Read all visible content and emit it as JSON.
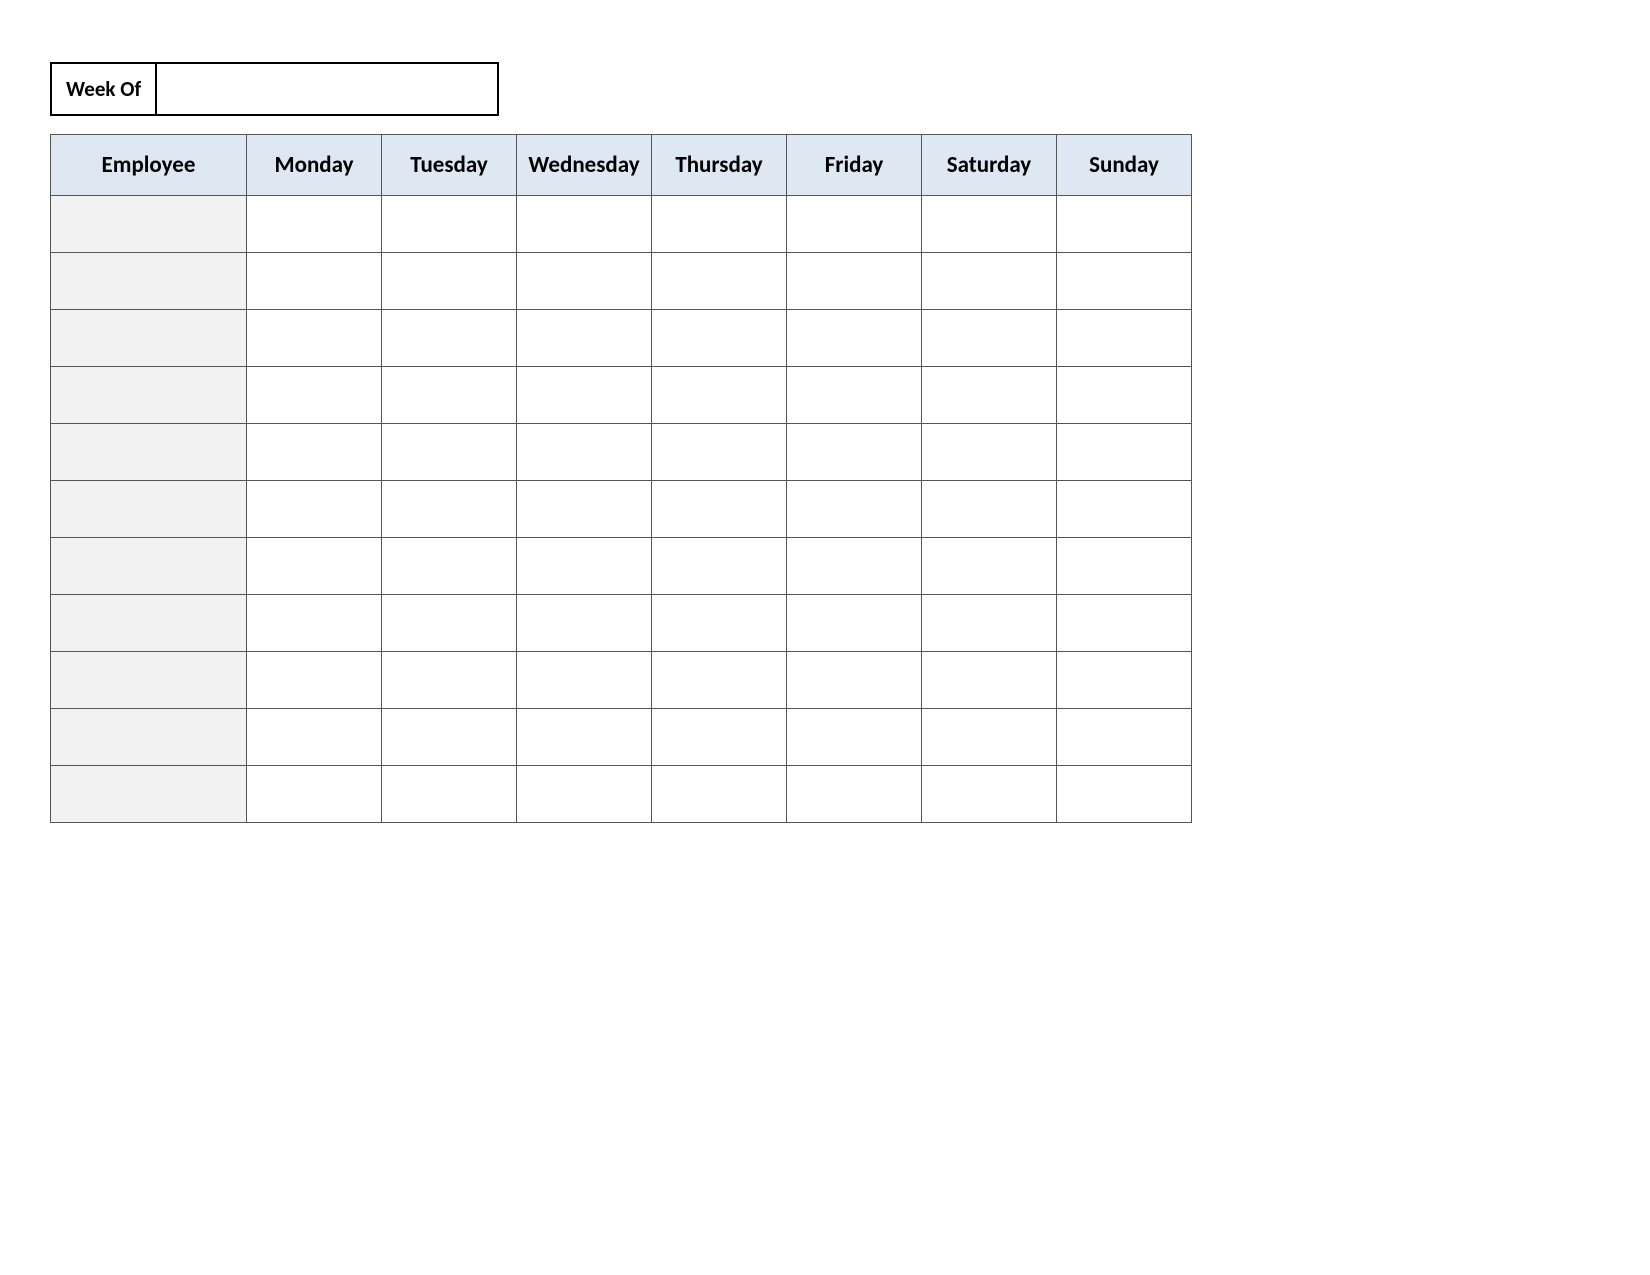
{
  "weekOf": {
    "label": "Week Of",
    "value": ""
  },
  "columns": [
    "Employee",
    "Monday",
    "Tuesday",
    "Wednesday",
    "Thursday",
    "Friday",
    "Saturday",
    "Sunday"
  ],
  "rows": [
    {
      "employee": "",
      "mon": "",
      "tue": "",
      "wed": "",
      "thu": "",
      "fri": "",
      "sat": "",
      "sun": ""
    },
    {
      "employee": "",
      "mon": "",
      "tue": "",
      "wed": "",
      "thu": "",
      "fri": "",
      "sat": "",
      "sun": ""
    },
    {
      "employee": "",
      "mon": "",
      "tue": "",
      "wed": "",
      "thu": "",
      "fri": "",
      "sat": "",
      "sun": ""
    },
    {
      "employee": "",
      "mon": "",
      "tue": "",
      "wed": "",
      "thu": "",
      "fri": "",
      "sat": "",
      "sun": ""
    },
    {
      "employee": "",
      "mon": "",
      "tue": "",
      "wed": "",
      "thu": "",
      "fri": "",
      "sat": "",
      "sun": ""
    },
    {
      "employee": "",
      "mon": "",
      "tue": "",
      "wed": "",
      "thu": "",
      "fri": "",
      "sat": "",
      "sun": ""
    },
    {
      "employee": "",
      "mon": "",
      "tue": "",
      "wed": "",
      "thu": "",
      "fri": "",
      "sat": "",
      "sun": ""
    },
    {
      "employee": "",
      "mon": "",
      "tue": "",
      "wed": "",
      "thu": "",
      "fri": "",
      "sat": "",
      "sun": ""
    },
    {
      "employee": "",
      "mon": "",
      "tue": "",
      "wed": "",
      "thu": "",
      "fri": "",
      "sat": "",
      "sun": ""
    },
    {
      "employee": "",
      "mon": "",
      "tue": "",
      "wed": "",
      "thu": "",
      "fri": "",
      "sat": "",
      "sun": ""
    },
    {
      "employee": "",
      "mon": "",
      "tue": "",
      "wed": "",
      "thu": "",
      "fri": "",
      "sat": "",
      "sun": ""
    }
  ]
}
